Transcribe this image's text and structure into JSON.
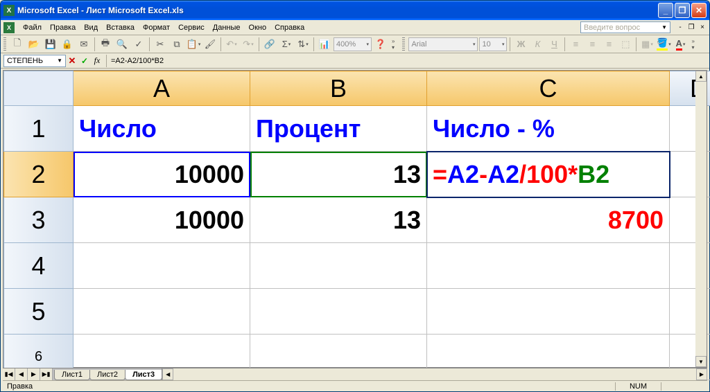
{
  "window": {
    "title": "Microsoft Excel - Лист Microsoft Excel.xls"
  },
  "menu": {
    "items": [
      "Файл",
      "Правка",
      "Вид",
      "Вставка",
      "Формат",
      "Сервис",
      "Данные",
      "Окно",
      "Справка"
    ],
    "question_placeholder": "Введите вопрос"
  },
  "toolbar": {
    "zoom": "400%",
    "font_name": "Arial",
    "font_size": "10"
  },
  "formula_bar": {
    "name_box": "СТЕПЕНЬ",
    "formula": "=A2-A2/100*B2"
  },
  "grid": {
    "columns": [
      "A",
      "B",
      "C",
      "D"
    ],
    "active_columns": [
      "A",
      "B",
      "C"
    ],
    "rows": [
      "1",
      "2",
      "3",
      "4",
      "5",
      "6"
    ],
    "active_rows": [
      "2"
    ],
    "cells": {
      "A1": "Число",
      "B1": "Процент",
      "C1": "Число - %",
      "A2": "10000",
      "B2": "13",
      "A3": "10000",
      "B3": "13",
      "C3": "8700"
    },
    "formula_cell": {
      "parts": [
        "=",
        "A2",
        "-",
        "A2",
        "/100*",
        "B2"
      ]
    }
  },
  "tabs": {
    "sheets": [
      "Лист1",
      "Лист2",
      "Лист3"
    ],
    "active": "Лист3"
  },
  "status": {
    "mode": "Правка",
    "indicator": "NUM"
  }
}
